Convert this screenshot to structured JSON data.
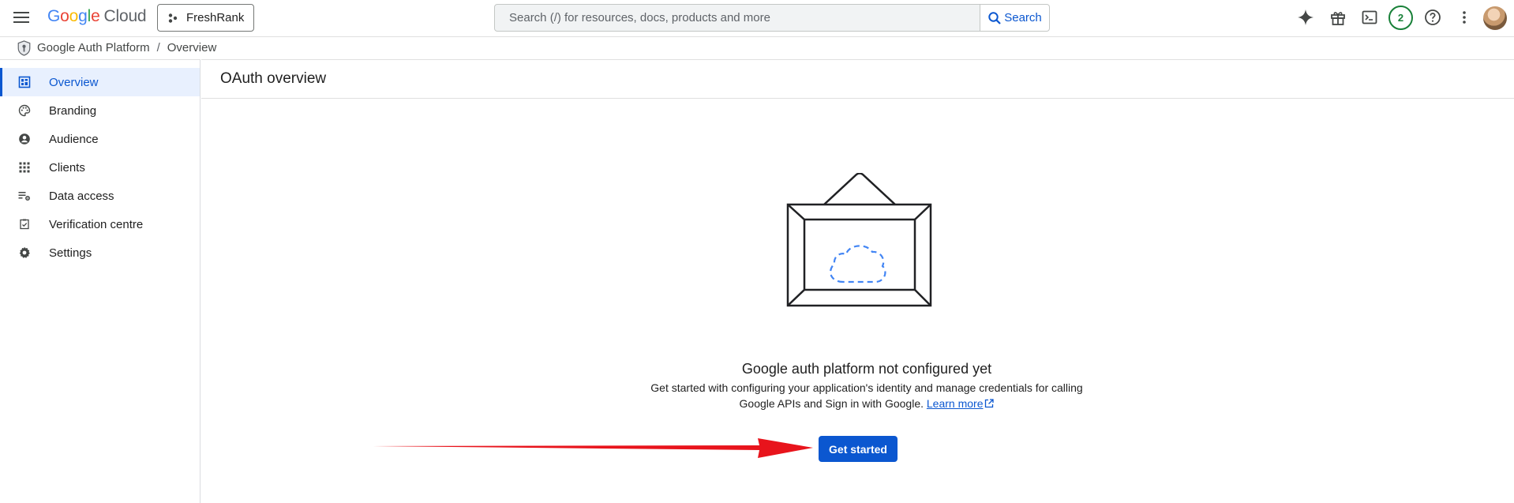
{
  "header": {
    "logo_google": "Google",
    "logo_cloud": "Cloud",
    "project_name": "FreshRank",
    "search_placeholder": "Search (/) for resources, docs, products and more",
    "search_button": "Search",
    "notification_count": "2"
  },
  "breadcrumb": {
    "items": [
      "Google Auth Platform",
      "Overview"
    ],
    "separator": "/"
  },
  "sidebar": {
    "items": [
      {
        "label": "Overview",
        "icon": "dashboard-icon",
        "active": true
      },
      {
        "label": "Branding",
        "icon": "palette-icon"
      },
      {
        "label": "Audience",
        "icon": "account-circle-icon"
      },
      {
        "label": "Clients",
        "icon": "apps-grid-icon"
      },
      {
        "label": "Data access",
        "icon": "data-access-icon"
      },
      {
        "label": "Verification centre",
        "icon": "verification-icon"
      },
      {
        "label": "Settings",
        "icon": "gear-icon"
      }
    ]
  },
  "main": {
    "title": "OAuth overview",
    "empty_state": {
      "title": "Google auth platform not configured yet",
      "description": "Get started with configuring your application's identity and manage credentials for calling Google APIs and Sign in with Google.",
      "link_label": "Learn more",
      "button_label": "Get started"
    }
  },
  "colors": {
    "accent": "#0b57d0",
    "active_bg": "#e8f0fe",
    "annotation_arrow": "#e8141c",
    "badge": "#188038"
  }
}
